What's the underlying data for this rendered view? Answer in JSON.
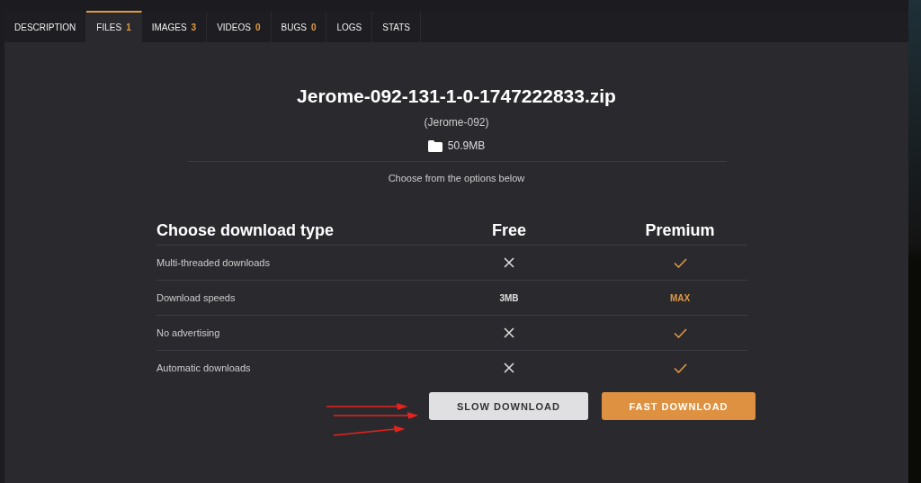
{
  "tabs": [
    {
      "label": "DESCRIPTION",
      "selected": false
    },
    {
      "label": "FILES",
      "count": "1",
      "selected": true
    },
    {
      "label": "IMAGES",
      "count": "3",
      "selected": false
    },
    {
      "label": "VIDEOS",
      "count": "0",
      "selected": false
    },
    {
      "label": "BUGS",
      "count": "0",
      "selected": false
    },
    {
      "label": "LOGS",
      "selected": false
    },
    {
      "label": "STATS",
      "selected": false
    }
  ],
  "file": {
    "name": "Jerome-092-131-1-0-1747222833.zip",
    "author": "(Jerome-092)",
    "size": "50.9MB"
  },
  "hint": "Choose from the options below",
  "table": {
    "columns": [
      "Choose download type",
      "Free",
      "Premium"
    ],
    "rows": [
      {
        "feature": "Multi-threaded downloads",
        "free": {
          "kind": "cross"
        },
        "premium": {
          "kind": "check"
        }
      },
      {
        "feature": "Download speeds",
        "free": {
          "kind": "text",
          "text": "3MB"
        },
        "premium": {
          "kind": "text",
          "text": "MAX"
        }
      },
      {
        "feature": "No advertising",
        "free": {
          "kind": "cross"
        },
        "premium": {
          "kind": "check"
        }
      },
      {
        "feature": "Automatic downloads",
        "free": {
          "kind": "cross"
        },
        "premium": {
          "kind": "check"
        }
      }
    ]
  },
  "buttons": [
    {
      "label": "SLOW DOWNLOAD",
      "kind": "secondary"
    },
    {
      "label": "FAST DOWNLOAD",
      "kind": "primary"
    }
  ],
  "annotation_arrows": [
    {
      "kind": "arrow"
    },
    {
      "kind": "arrow"
    },
    {
      "kind": "arrow"
    }
  ]
}
